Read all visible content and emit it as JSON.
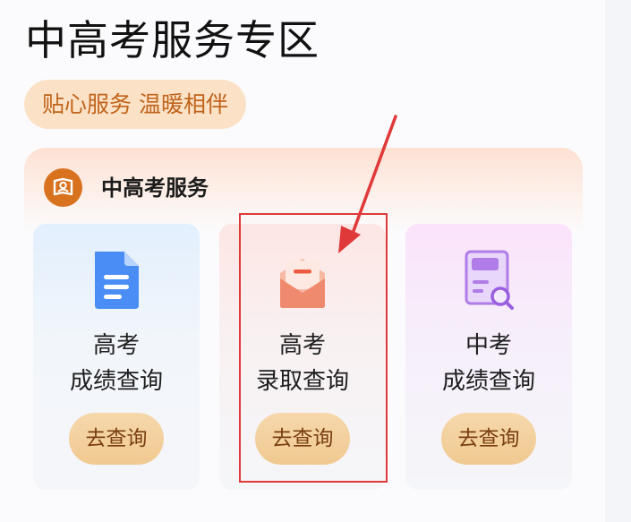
{
  "page": {
    "title": "中高考服务专区",
    "slogan": "贴心服务 温暖相伴"
  },
  "service": {
    "title": "中高考服务",
    "icon": "certificate-icon",
    "tiles": [
      {
        "line1": "高考",
        "line2": "成绩查询",
        "button": "去查询",
        "icon": "document-icon",
        "accent": "#3b82f6"
      },
      {
        "line1": "高考",
        "line2": "录取查询",
        "button": "去查询",
        "icon": "envelope-icon",
        "accent": "#f08a6e"
      },
      {
        "line1": "中考",
        "line2": "成绩查询",
        "button": "去查询",
        "icon": "exam-search-icon",
        "accent": "#b07ce8"
      }
    ]
  },
  "colors": {
    "slogan_bg": "#fbe2c7",
    "slogan_text": "#c0631a",
    "button_bg": "#f3d19e",
    "button_text": "#7a3e10",
    "highlight": "#e0393a"
  }
}
